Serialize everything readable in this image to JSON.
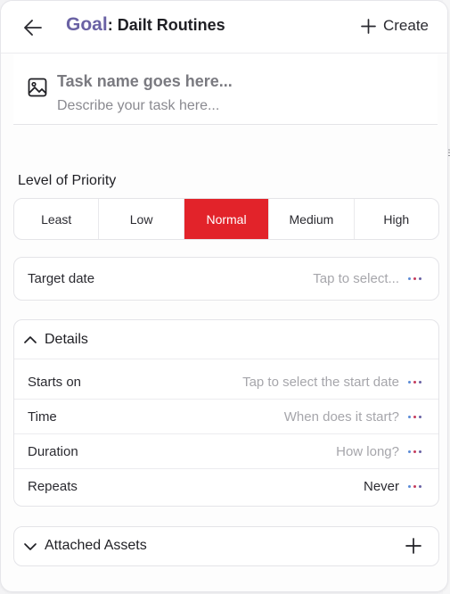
{
  "header": {
    "goal_label": "Goal",
    "colon": ":",
    "goal_name": " Dailt Routines",
    "create_label": "Create"
  },
  "task": {
    "name_placeholder": "Task name goes here...",
    "description_placeholder": "Describe your task here..."
  },
  "priority": {
    "label": "Level of Priority",
    "options": [
      "Least",
      "Low",
      "Normal",
      "Medium",
      "High"
    ],
    "selected": "Normal",
    "active_color": "#e2232a"
  },
  "target_date": {
    "label": "Target date",
    "placeholder": "Tap to select..."
  },
  "details": {
    "title": "Details",
    "expanded": true,
    "rows": [
      {
        "label": "Starts on",
        "value": "Tap to select the start date"
      },
      {
        "label": "Time",
        "value": "When does it start?"
      },
      {
        "label": "Duration",
        "value": "How long?"
      },
      {
        "label": "Repeats",
        "value": "Never"
      }
    ]
  },
  "attached_assets": {
    "title": "Attached Assets",
    "expanded": false
  },
  "background": {
    "peek_char": "e"
  },
  "colors": {
    "accent": "#6a62a4",
    "priority_active": "#e2232a",
    "menu_dots": [
      "#5b8bd6",
      "#c53b5c",
      "#6a62a4"
    ]
  },
  "icons": {
    "back": "arrow-left-icon",
    "create": "plus-icon",
    "image": "image-icon",
    "menu": "more-dots-icon",
    "details_toggle": "chevron-up-icon",
    "assets_toggle": "chevron-down-icon",
    "add_asset": "plus-icon"
  }
}
